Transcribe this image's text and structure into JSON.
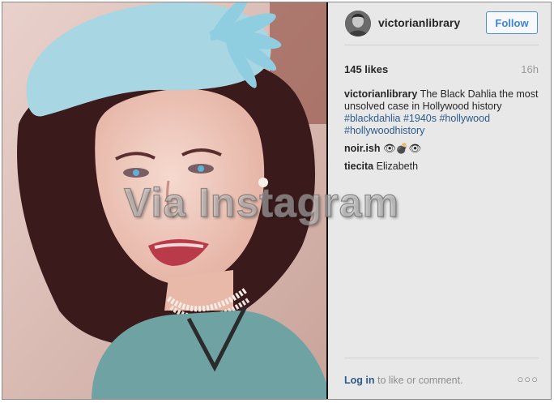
{
  "post": {
    "username": "victorianlibrary",
    "follow_label": "Follow",
    "likes": "145 likes",
    "time": "16h",
    "caption_text": "The Black Dahlia the most unsolved case in Hollywood history",
    "hashtags": [
      "#blackdahlia",
      "#1940s",
      "#hollywood",
      "#hollywoodhistory"
    ]
  },
  "comments": [
    {
      "user": "noir.ish",
      "text": "👁💣👁"
    },
    {
      "user": "tiecita",
      "text": "Elizabeth"
    }
  ],
  "footer": {
    "login_label": "Log in",
    "rest_text": "to like or comment.",
    "more_label": "○○○"
  },
  "watermark": "Via Instagram",
  "colors": {
    "link": "#2b5a8a",
    "follow_border": "#4c8fd6",
    "panel_bg": "#e8e8e8"
  },
  "icons": {
    "avatar": "profile-photo",
    "more": "ellipsis-icon"
  }
}
